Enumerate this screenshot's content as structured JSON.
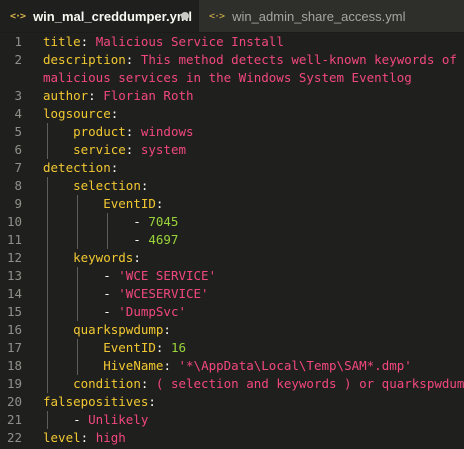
{
  "tabs": [
    {
      "label": "win_mal_creddumper.yml",
      "icon": "file-code-icon"
    },
    {
      "label": "win_admin_share_access.yml",
      "icon": "file-code-icon"
    }
  ],
  "lines": [
    {
      "num": "1",
      "parts": [
        [
          "k",
          "title"
        ],
        [
          "d",
          ": "
        ],
        [
          "v",
          "Malicious Service Install"
        ]
      ],
      "guides": 0
    },
    {
      "num": "2",
      "parts": [
        [
          "k",
          "description"
        ],
        [
          "d",
          ": "
        ],
        [
          "v",
          "This method detects well-known keywords of"
        ]
      ],
      "guides": 0
    },
    {
      "num": "",
      "parts": [
        [
          "v",
          "malicious services in the Windows System Eventlog"
        ]
      ],
      "guides": 0
    },
    {
      "num": "3",
      "parts": [
        [
          "k",
          "author"
        ],
        [
          "d",
          ": "
        ],
        [
          "v",
          "Florian Roth"
        ]
      ],
      "guides": 0
    },
    {
      "num": "4",
      "parts": [
        [
          "k",
          "logsource"
        ],
        [
          "d",
          ":"
        ]
      ],
      "guides": 0
    },
    {
      "num": "5",
      "parts": [
        [
          "d",
          "    "
        ],
        [
          "k",
          "product"
        ],
        [
          "d",
          ": "
        ],
        [
          "v",
          "windows"
        ]
      ],
      "guides": 1
    },
    {
      "num": "6",
      "parts": [
        [
          "d",
          "    "
        ],
        [
          "k",
          "service"
        ],
        [
          "d",
          ": "
        ],
        [
          "v",
          "system"
        ]
      ],
      "guides": 1
    },
    {
      "num": "7",
      "parts": [
        [
          "k",
          "detection"
        ],
        [
          "d",
          ":"
        ]
      ],
      "guides": 0
    },
    {
      "num": "8",
      "parts": [
        [
          "d",
          "    "
        ],
        [
          "k",
          "selection"
        ],
        [
          "d",
          ":"
        ]
      ],
      "guides": 1
    },
    {
      "num": "9",
      "parts": [
        [
          "d",
          "        "
        ],
        [
          "k",
          "EventID"
        ],
        [
          "d",
          ":"
        ]
      ],
      "guides": 2
    },
    {
      "num": "10",
      "parts": [
        [
          "d",
          "            - "
        ],
        [
          "n",
          "7045"
        ]
      ],
      "guides": 3
    },
    {
      "num": "11",
      "parts": [
        [
          "d",
          "            - "
        ],
        [
          "n",
          "4697"
        ]
      ],
      "guides": 3
    },
    {
      "num": "12",
      "parts": [
        [
          "d",
          "    "
        ],
        [
          "k",
          "keywords"
        ],
        [
          "d",
          ":"
        ]
      ],
      "guides": 1
    },
    {
      "num": "13",
      "parts": [
        [
          "d",
          "        - "
        ],
        [
          "s",
          "'WCE SERVICE'"
        ]
      ],
      "guides": 2
    },
    {
      "num": "14",
      "parts": [
        [
          "d",
          "        - "
        ],
        [
          "s",
          "'WCESERVICE'"
        ]
      ],
      "guides": 2
    },
    {
      "num": "15",
      "parts": [
        [
          "d",
          "        - "
        ],
        [
          "s",
          "'DumpSvc'"
        ]
      ],
      "guides": 2
    },
    {
      "num": "16",
      "parts": [
        [
          "d",
          "    "
        ],
        [
          "k",
          "quarkspwdump"
        ],
        [
          "d",
          ":"
        ]
      ],
      "guides": 1
    },
    {
      "num": "17",
      "parts": [
        [
          "d",
          "        "
        ],
        [
          "k",
          "EventID"
        ],
        [
          "d",
          ": "
        ],
        [
          "n",
          "16"
        ]
      ],
      "guides": 2
    },
    {
      "num": "18",
      "parts": [
        [
          "d",
          "        "
        ],
        [
          "k",
          "HiveName"
        ],
        [
          "d",
          ": "
        ],
        [
          "s",
          "'*\\AppData\\Local\\Temp\\SAM*.dmp'"
        ]
      ],
      "guides": 2
    },
    {
      "num": "19",
      "parts": [
        [
          "d",
          "    "
        ],
        [
          "k",
          "condition"
        ],
        [
          "d",
          ": "
        ],
        [
          "v",
          "( selection and keywords ) or quarkspwdump"
        ]
      ],
      "guides": 1
    },
    {
      "num": "20",
      "parts": [
        [
          "k",
          "falsepositives"
        ],
        [
          "d",
          ":"
        ]
      ],
      "guides": 0
    },
    {
      "num": "21",
      "parts": [
        [
          "d",
          "    - "
        ],
        [
          "v",
          "Unlikely"
        ]
      ],
      "guides": 1
    },
    {
      "num": "22",
      "parts": [
        [
          "k",
          "level"
        ],
        [
          "d",
          ": "
        ],
        [
          "v",
          "high"
        ]
      ],
      "guides": 0
    }
  ]
}
